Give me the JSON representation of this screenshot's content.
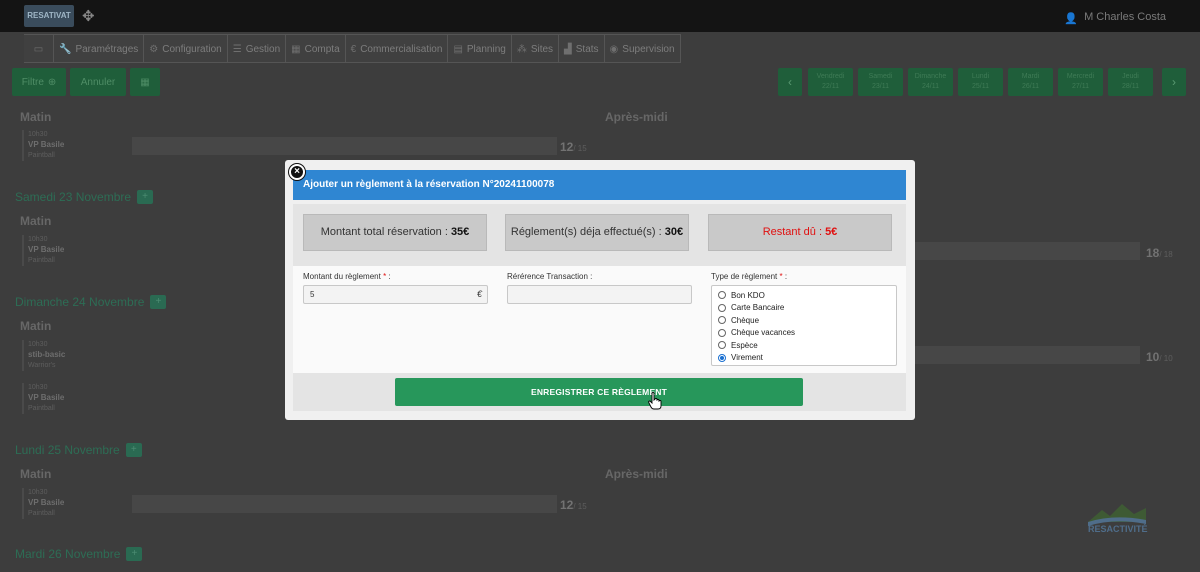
{
  "app": {
    "logo_text": "RESATIVAT",
    "user_name": "M Charles Costa"
  },
  "nav": {
    "items": [
      {
        "label": "",
        "icon": "monitor-icon"
      },
      {
        "label": "Paramétrages",
        "icon": "wrench-icon"
      },
      {
        "label": "Configuration",
        "icon": "gears-icon"
      },
      {
        "label": "Gestion",
        "icon": "list-icon"
      },
      {
        "label": "Compta",
        "icon": "calculator-icon"
      },
      {
        "label": "Commercialisation",
        "icon": "euro-icon"
      },
      {
        "label": "Planning",
        "icon": "calendar-icon"
      },
      {
        "label": "Sites",
        "icon": "sitemap-icon"
      },
      {
        "label": "Stats",
        "icon": "chart-icon"
      },
      {
        "label": "Supervision",
        "icon": "eye-icon"
      }
    ]
  },
  "toolbar": {
    "filter_label": "Filtre",
    "cancel_label": "Annuler",
    "prev_arrow": "‹",
    "next_arrow": "›",
    "days": [
      {
        "name": "Vendredi",
        "date": "22/11"
      },
      {
        "name": "Samedi",
        "date": "23/11"
      },
      {
        "name": "Dimanche",
        "date": "24/11"
      },
      {
        "name": "Lundi",
        "date": "25/11"
      },
      {
        "name": "Mardi",
        "date": "26/11"
      },
      {
        "name": "Mercredi",
        "date": "27/11"
      },
      {
        "name": "Jeudi",
        "date": "28/11"
      }
    ]
  },
  "background": {
    "morning_label": "Matin",
    "afternoon_label": "Après-midi",
    "days": [
      {
        "title": "Samedi 23 Novembre"
      },
      {
        "title": "Dimanche 24 Novembre"
      },
      {
        "title": "Lundi 25 Novembre"
      },
      {
        "title": "Mardi 26 Novembre"
      }
    ],
    "slots": [
      {
        "time": "10h30",
        "activity": "VP Basile",
        "place": "Paintball",
        "count": "12",
        "max": "/ 15"
      },
      {
        "time": "10h30",
        "activity": "VP Basile",
        "place": "Paintball",
        "count": "18",
        "max": "/ 18"
      },
      {
        "time": "10h30",
        "activity": "stib-basic",
        "place": "Warrior's",
        "count": "10",
        "max": "/ 10"
      },
      {
        "time": "10h30",
        "activity": "VP Basile",
        "place": "Paintball",
        "count": "",
        "max": ""
      },
      {
        "time": "10h30",
        "activity": "VP Basile",
        "place": "Paintball",
        "count": "12",
        "max": "/ 15"
      }
    ],
    "brand_text": "RESACTIVITÉ"
  },
  "modal": {
    "close_symbol": "×",
    "title": "Ajouter un règlement à la réservation N°20241100078",
    "total": {
      "label": "Montant total réservation : ",
      "value": "35€"
    },
    "paid": {
      "label": "Réglement(s) déja effectué(s) : ",
      "value": "30€"
    },
    "remaining": {
      "label": "Restant dû : ",
      "value": "5€"
    },
    "amount_label": "Montant du règlement",
    "amount_value": "5",
    "currency": "€",
    "reference_label": "Rérérence Transaction :",
    "reference_value": "",
    "type_label": "Type de règlement",
    "required_mark": "*",
    "label_suffix": " :",
    "payment_types": [
      {
        "label": "Bon KDO",
        "checked": false
      },
      {
        "label": "Carte Bancaire",
        "checked": false
      },
      {
        "label": "Chèque",
        "checked": false
      },
      {
        "label": "Chèque vacances",
        "checked": false
      },
      {
        "label": "Espèce",
        "checked": false
      },
      {
        "label": "Virement",
        "checked": true
      }
    ],
    "save_label": "ENREGISTRER CE RÈGLEMENT"
  }
}
